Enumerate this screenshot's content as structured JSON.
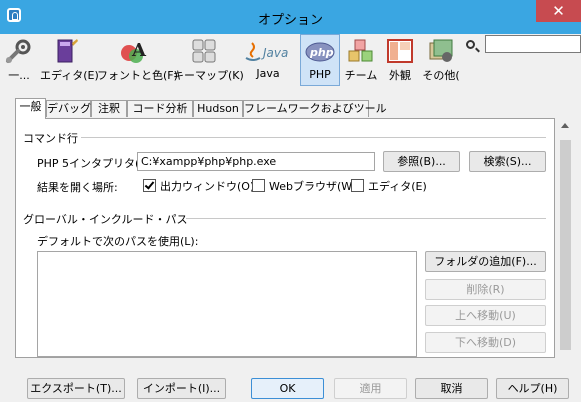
{
  "window": {
    "title": "オプション",
    "close_glyph": "✕"
  },
  "toolbar": {
    "items": [
      {
        "label": "一...",
        "icon": "wrench-gear-icon"
      },
      {
        "label": "エディタ(E)",
        "icon": "editor-book-icon"
      },
      {
        "label": "フォントと色(F)",
        "icon": "font-color-icon"
      },
      {
        "label": "キーマップ(K)",
        "icon": "keyboard-icon"
      },
      {
        "label": "Java",
        "icon": "java-icon"
      },
      {
        "label": "PHP",
        "icon": "php-icon",
        "selected": true
      },
      {
        "label": "チーム",
        "icon": "team-cubes-icon"
      },
      {
        "label": "外観",
        "icon": "appearance-windows-icon"
      },
      {
        "label": "その他(",
        "icon": "misc-folder-icon"
      }
    ],
    "search_value": "",
    "java_text": "Java",
    "php_text": "php"
  },
  "tabs": [
    "一般",
    "デバッグ",
    "注釈",
    "コード分析",
    "Hudson",
    "フレームワークおよびツール"
  ],
  "active_tab": 0,
  "command_line": {
    "section_title": "コマンド行",
    "interpreter_label": "PHP 5インタプリタ(P):",
    "interpreter_value": "C:¥xampp¥php¥php.exe",
    "browse_button": "参照(B)...",
    "search_button": "検索(S)...",
    "open_result_label": "結果を開く場所:",
    "output_window": {
      "label": "出力ウィンドウ(O)",
      "checked": true
    },
    "web_browser": {
      "label": "Webブラウザ(W)",
      "checked": false
    },
    "editor": {
      "label": "エディタ(E)",
      "checked": false
    }
  },
  "include_path": {
    "section_title": "グローバル・インクルード・パス",
    "default_label": "デフォルトで次のパスを使用(L):",
    "add_folder_button": "フォルダの追加(F)...",
    "remove_button": "削除(R)",
    "move_up_button": "上へ移動(U)",
    "move_down_button": "下へ移動(D)"
  },
  "footer": {
    "export_button": "エクスポート(T)...",
    "import_button": "インポート(I)...",
    "ok_button": "OK",
    "apply_button": "適用",
    "cancel_button": "取消",
    "help_button": "ヘルプ(H)"
  },
  "colors": {
    "titlebar": "#3aa6e2",
    "close": "#c74b50",
    "selected_tool": "#cfe3f7"
  }
}
